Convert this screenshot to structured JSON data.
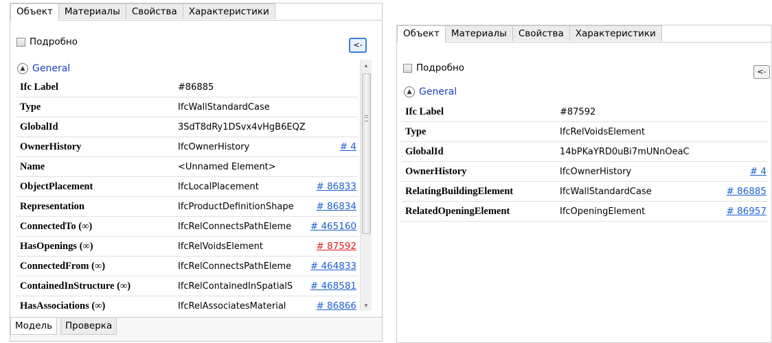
{
  "tabs": [
    "Объект",
    "Материалы",
    "Свойства",
    "Характеристики"
  ],
  "detailed_label": "Подробно",
  "back_label": "<-",
  "group_label": "General",
  "left_rows": [
    {
      "key": "Ifc Label",
      "value": "#86885",
      "ref": ""
    },
    {
      "key": "Type",
      "value": "IfcWallStandardCase",
      "ref": ""
    },
    {
      "key": "GlobalId",
      "value": "3SdT8dRy1DSvx4vHgB6EQZ",
      "ref": ""
    },
    {
      "key": "OwnerHistory",
      "value": "IfcOwnerHistory",
      "ref": "# 4"
    },
    {
      "key": "Name",
      "value": "<Unnamed Element>",
      "ref": ""
    },
    {
      "key": "ObjectPlacement",
      "value": "IfcLocalPlacement",
      "ref": "# 86833"
    },
    {
      "key": "Representation",
      "value": "IfcProductDefinitionShape",
      "ref": "# 86834"
    },
    {
      "key": "ConnectedTo (∞)",
      "value": "IfcRelConnectsPathEleme",
      "ref": "# 465160"
    },
    {
      "key": "HasOpenings (∞)",
      "value": "IfcRelVoidsElement",
      "ref": "# 87592",
      "highlight": true
    },
    {
      "key": "ConnectedFrom (∞)",
      "value": "IfcRelConnectsPathEleme",
      "ref": "# 464833"
    },
    {
      "key": "ContainedInStructure (∞)",
      "value": "IfcRelContainedInSpatialS",
      "ref": "# 468581"
    },
    {
      "key": "HasAssociations (∞)",
      "value": "IfcRelAssociatesMaterial",
      "ref": "# 86866"
    }
  ],
  "right_rows": [
    {
      "key": "Ifc Label",
      "value": "#87592",
      "ref": ""
    },
    {
      "key": "Type",
      "value": "IfcRelVoidsElement",
      "ref": ""
    },
    {
      "key": "GlobalId",
      "value": "14bPKaYRD0uBi7mUNnOeaC",
      "ref": ""
    },
    {
      "key": "OwnerHistory",
      "value": "IfcOwnerHistory",
      "ref": "# 4"
    },
    {
      "key": "RelatingBuildingElement",
      "value": "IfcWallStandardCase",
      "ref": "# 86885"
    },
    {
      "key": "RelatedOpeningElement",
      "value": "IfcOpeningElement",
      "ref": "# 86957"
    }
  ],
  "bottom_tabs": [
    "Модель",
    "Проверка"
  ],
  "colors": {
    "link": "#1a5fd0",
    "highlight_link": "#e11b1b",
    "group": "#1a3fc7",
    "active_button": "#3a7fd6"
  }
}
